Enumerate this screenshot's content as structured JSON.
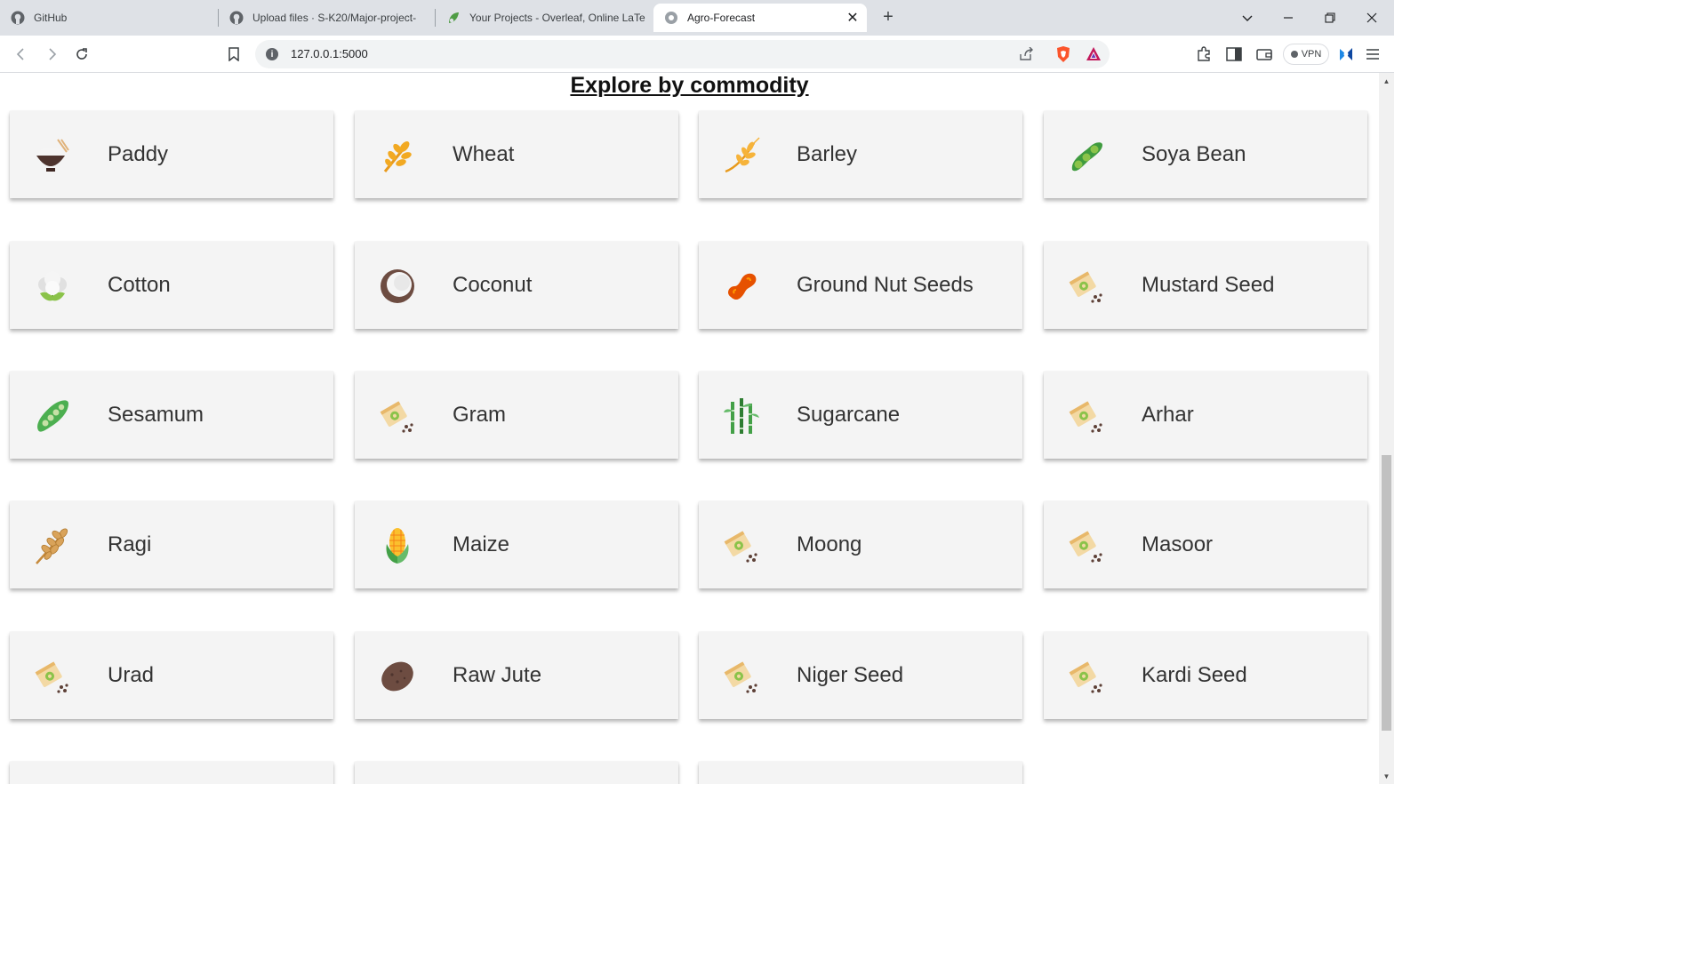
{
  "browser": {
    "tabs": [
      {
        "title": "GitHub",
        "icon": "github-icon"
      },
      {
        "title": "Upload files · S-K20/Major-project-",
        "icon": "github-icon"
      },
      {
        "title": "Your Projects - Overleaf, Online LaTe",
        "icon": "overleaf-icon"
      },
      {
        "title": "Agro-Forecast",
        "icon": "globe-icon",
        "active": true
      }
    ],
    "url": "127.0.0.1:5000",
    "vpn_label": "VPN"
  },
  "page": {
    "heading": "Explore by commodity",
    "commodities": [
      {
        "name": "Paddy",
        "icon": "rice-bowl-icon"
      },
      {
        "name": "Wheat",
        "icon": "wheat-icon"
      },
      {
        "name": "Barley",
        "icon": "barley-icon"
      },
      {
        "name": "Soya Bean",
        "icon": "soybean-icon"
      },
      {
        "name": "Cotton",
        "icon": "cotton-icon"
      },
      {
        "name": "Coconut",
        "icon": "coconut-icon"
      },
      {
        "name": "Ground Nut Seeds",
        "icon": "peanut-icon"
      },
      {
        "name": "Mustard Seed",
        "icon": "seed-packet-icon"
      },
      {
        "name": "Sesamum",
        "icon": "pea-pod-icon"
      },
      {
        "name": "Gram",
        "icon": "seed-packet-icon"
      },
      {
        "name": "Sugarcane",
        "icon": "sugarcane-icon"
      },
      {
        "name": "Arhar",
        "icon": "seed-packet-icon"
      },
      {
        "name": "Ragi",
        "icon": "millet-icon"
      },
      {
        "name": "Maize",
        "icon": "corn-icon"
      },
      {
        "name": "Moong",
        "icon": "seed-packet-icon"
      },
      {
        "name": "Masoor",
        "icon": "seed-packet-icon"
      },
      {
        "name": "Urad",
        "icon": "seed-packet-icon"
      },
      {
        "name": "Raw Jute",
        "icon": "potato-icon"
      },
      {
        "name": "Niger Seed",
        "icon": "seed-packet-icon"
      },
      {
        "name": "Kardi Seed",
        "icon": "seed-packet-icon"
      }
    ]
  }
}
